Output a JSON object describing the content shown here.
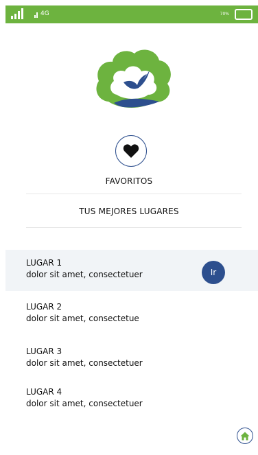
{
  "status_bar": {
    "network": "4G",
    "battery_percent_text": "70%",
    "battery_level": 0.7,
    "accent_color": "#6db33f"
  },
  "favorites": {
    "icon": "heart-icon",
    "label": "FAVORITOS"
  },
  "subtitle": "TUS MEJORES LUGARES",
  "places": [
    {
      "title": "LUGAR 1",
      "description": "dolor sit amet, consectetuer",
      "button_label": "Ir",
      "highlighted": true
    },
    {
      "title": "LUGAR 2",
      "description": "dolor sit amet, consectetue"
    },
    {
      "title": "LUGAR 3",
      "description": "dolor sit amet, consectetuer"
    },
    {
      "title": "LUGAR 4",
      "description": "dolor sit amet, consectetuer"
    }
  ],
  "home_button": {
    "icon": "home-icon"
  },
  "colors": {
    "primary_blue": "#2d4f8e",
    "brand_green": "#6db33f",
    "highlight_bg": "#f1f4f7"
  }
}
